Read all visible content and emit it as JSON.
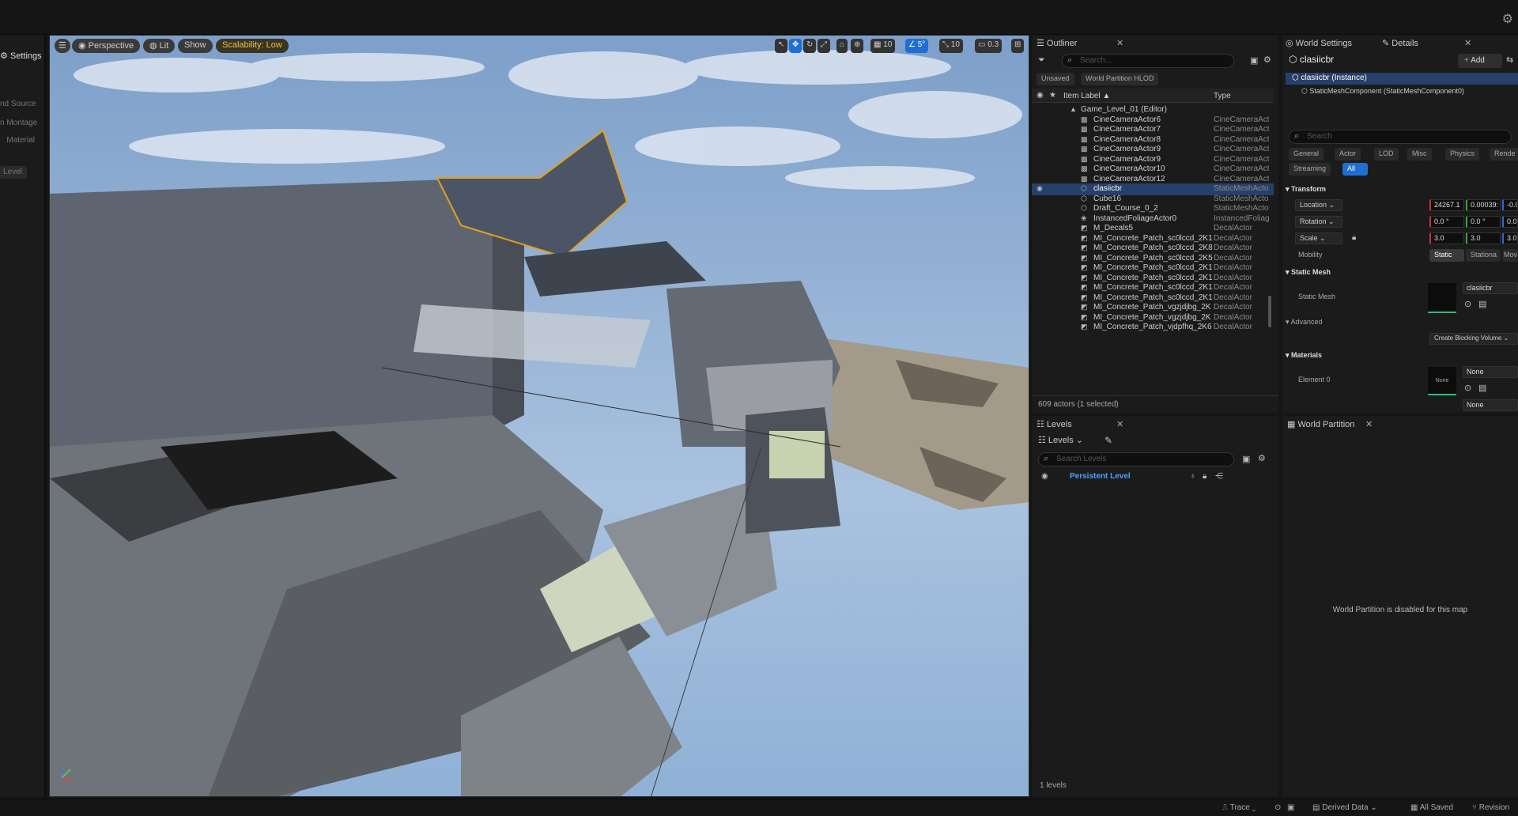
{
  "toolbar": {
    "settings_icon": "gear-icon"
  },
  "left_panel": {
    "settings": "Settings",
    "items": [
      "nd Source",
      "n Montage",
      "Material"
    ],
    "level": "Level"
  },
  "viewport": {
    "menu_icon": "hamburger-icon",
    "perspective": "Perspective",
    "lit": "Lit",
    "show": "Show",
    "scalability": "Scalability: Low",
    "grid_snap": "10",
    "rot_snap": "5°",
    "scale_snap": "10",
    "camera_speed": "0.3",
    "sky_color": "#8fb1d6"
  },
  "outliner": {
    "tab": "Outliner",
    "search_placeholder": "Search...",
    "filters": [
      "Unsaved",
      "World Partition HLOD"
    ],
    "col_label": "Item Label ▲",
    "col_type": "Type",
    "rows": [
      {
        "label": "Game_Level_01 (Editor)",
        "type": "",
        "icon": "level-icon"
      },
      {
        "label": "CineCameraActor6",
        "type": "CineCameraAct",
        "icon": "camera-icon"
      },
      {
        "label": "CineCameraActor7",
        "type": "CineCameraAct",
        "icon": "camera-icon"
      },
      {
        "label": "CineCameraActor8",
        "type": "CineCameraAct",
        "icon": "camera-icon"
      },
      {
        "label": "CineCameraActor9",
        "type": "CineCameraAct",
        "icon": "camera-icon"
      },
      {
        "label": "CineCameraActor9",
        "type": "CineCameraAct",
        "icon": "camera-icon"
      },
      {
        "label": "CineCameraActor10",
        "type": "CineCameraAct",
        "icon": "camera-icon"
      },
      {
        "label": "CineCameraActor12",
        "type": "CineCameraAct",
        "icon": "camera-icon"
      },
      {
        "label": "clasiicbr",
        "type": "StaticMeshActo",
        "icon": "mesh-icon",
        "selected": true
      },
      {
        "label": "Cube16",
        "type": "StaticMeshActo",
        "icon": "mesh-icon"
      },
      {
        "label": "Draft_Course_0_2",
        "type": "StaticMeshActo",
        "icon": "mesh-icon"
      },
      {
        "label": "InstancedFoliageActor0",
        "type": "InstancedFoliag",
        "icon": "foliage-icon"
      },
      {
        "label": "M_Decals5",
        "type": "DecalActor",
        "icon": "decal-icon"
      },
      {
        "label": "MI_Concrete_Patch_sc0lccd_2K1",
        "type": "DecalActor",
        "icon": "decal-icon"
      },
      {
        "label": "MI_Concrete_Patch_sc0lccd_2K8",
        "type": "DecalActor",
        "icon": "decal-icon"
      },
      {
        "label": "MI_Concrete_Patch_sc0lccd_2K5",
        "type": "DecalActor",
        "icon": "decal-icon"
      },
      {
        "label": "MI_Concrete_Patch_sc0lccd_2K1",
        "type": "DecalActor",
        "icon": "decal-icon"
      },
      {
        "label": "MI_Concrete_Patch_sc0lccd_2K1",
        "type": "DecalActor",
        "icon": "decal-icon"
      },
      {
        "label": "MI_Concrete_Patch_sc0lccd_2K1",
        "type": "DecalActor",
        "icon": "decal-icon"
      },
      {
        "label": "MI_Concrete_Patch_sc0lccd_2K1",
        "type": "DecalActor",
        "icon": "decal-icon"
      },
      {
        "label": "MI_Concrete_Patch_vgzjdjbg_2K",
        "type": "DecalActor",
        "icon": "decal-icon"
      },
      {
        "label": "MI_Concrete_Patch_vgzjdjbg_2K",
        "type": "DecalActor",
        "icon": "decal-icon"
      },
      {
        "label": "MI_Concrete_Patch_vjdpfhq_2K6",
        "type": "DecalActor",
        "icon": "decal-icon"
      }
    ],
    "footer": "609 actors (1 selected)"
  },
  "levels": {
    "tab": "Levels",
    "dropdown": "Levels",
    "search_placeholder": "Search Levels",
    "persistent": "Persistent Level",
    "footer": "1 levels"
  },
  "details": {
    "tab_world": "World Settings",
    "tab_details": "Details",
    "object": "clasiicbr",
    "add": "Add",
    "instance": "clasiicbr (Instance)",
    "component": "StaticMeshComponent (StaticMeshComponent0)",
    "search_placeholder": "Search",
    "filters": [
      "General",
      "Actor",
      "LOD",
      "Misc",
      "Physics",
      "Rende"
    ],
    "filters2": [
      "Streaming",
      "All"
    ],
    "transform": "Transform",
    "location": "Location",
    "rotation": "Rotation",
    "scale": "Scale",
    "loc_vals": [
      "24267.1",
      "0.00039:",
      "-0.00"
    ],
    "rot_vals": [
      "0.0 °",
      "0.0 °",
      "0.0 °"
    ],
    "scale_vals": [
      "3.0",
      "3.0",
      "3.0"
    ],
    "mobility": "Mobility",
    "mobility_opts": [
      "Static",
      "Stationa",
      "Mov"
    ],
    "static_mesh_sect": "Static Mesh",
    "static_mesh_label": "Static Mesh",
    "static_mesh_val": "clasiicbr",
    "advanced": "Advanced",
    "blocking": "Create Blocking Volume",
    "materials": "Materials",
    "element0": "Element 0",
    "mat_none": "None",
    "mat_thumb_none": "None",
    "mat_none2": "None"
  },
  "world_partition": {
    "tab": "World Partition",
    "message": "World Partition is disabled for this map"
  },
  "status": {
    "trace": "Trace",
    "derived": "Derived Data",
    "saved": "All Saved",
    "revision": "Revision"
  }
}
